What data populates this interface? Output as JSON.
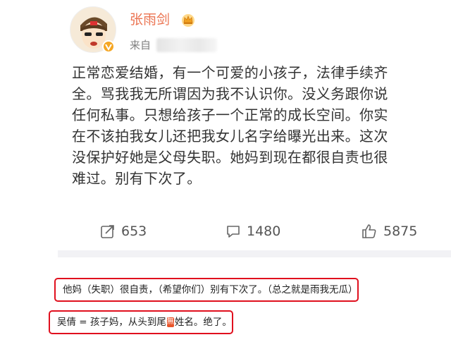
{
  "post": {
    "username": "张雨剑",
    "source_prefix": "来自",
    "content": "正常恋爱结婚，有一个可爱的小孩子，法律手续齐\n全。骂我我无所谓因为我不认识你。没义务跟你说\n任何私事。只想给孩子一个正常的成长空间。你实\n在不该拍我女儿还把我女儿名字给曝光出来。这次\n没保护好她是父母失职。她妈到现在都很自责也很\n难过。别有下次了。",
    "reposts": "653",
    "comments": "1480",
    "likes": "5875"
  },
  "captions": {
    "line1": "他妈（失职）很自责，（希望你们）别有下次了。（总之就是雨我无瓜）",
    "line2_before": "吴倩 = 孩子妈，从头到尾",
    "line2_emoji": "無",
    "line2_after": "姓名。绝了。"
  },
  "colors": {
    "username": "#eb7350",
    "caption_border": "#e0101e",
    "separator": "#f2f2f5"
  },
  "icons": [
    "avatar-cartoon",
    "verified-badge-icon",
    "crown-icon",
    "repost-icon",
    "comment-icon",
    "like-icon"
  ]
}
